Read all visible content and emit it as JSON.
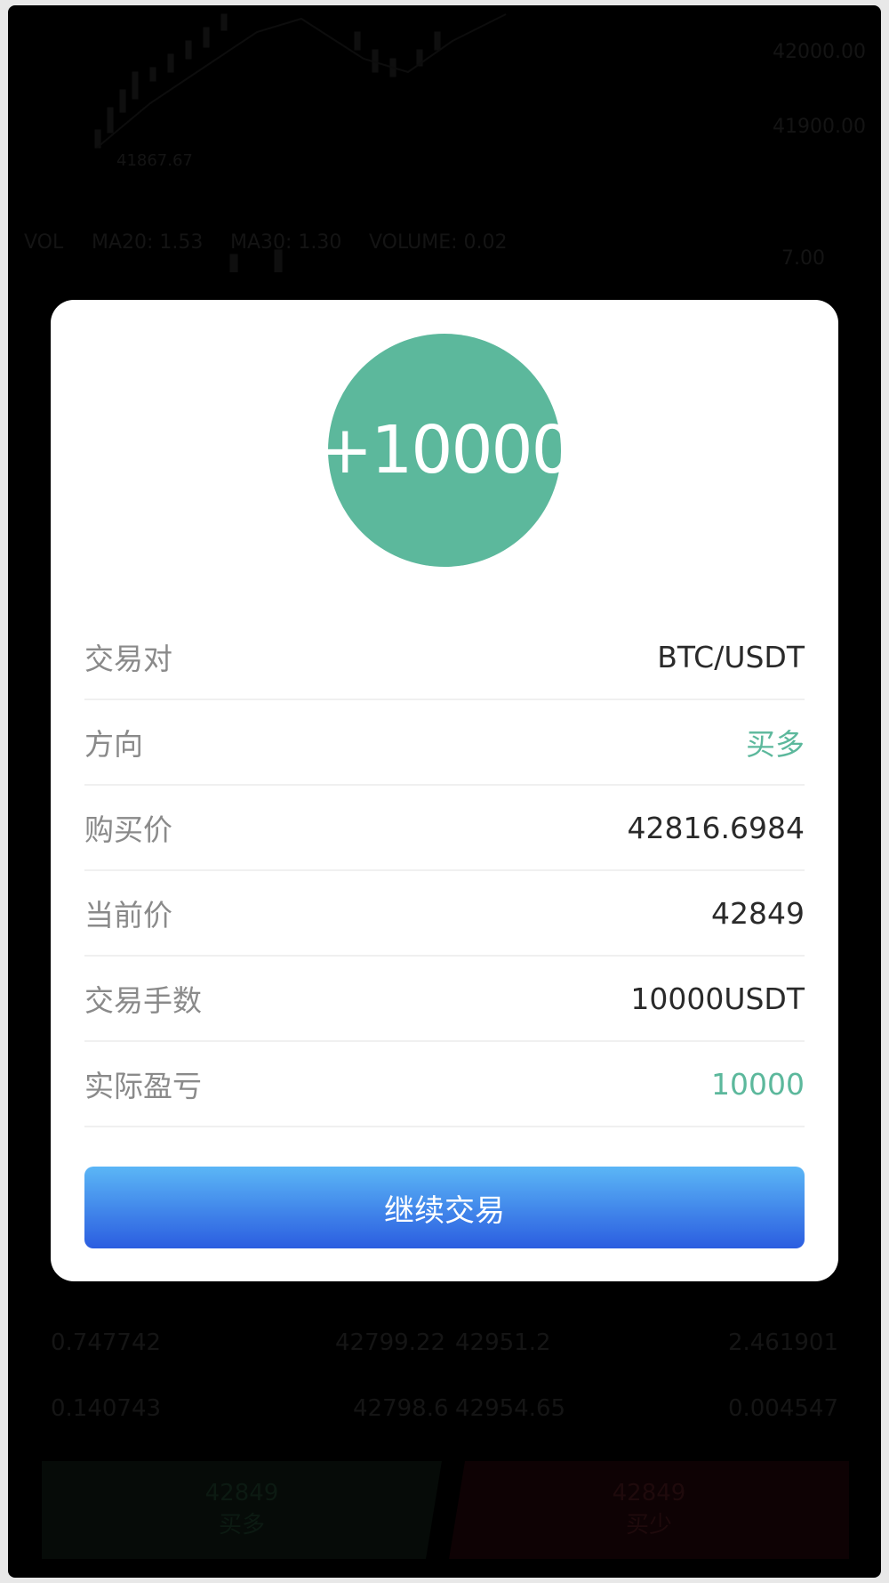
{
  "background": {
    "price_axis": [
      "42000.00",
      "41900.00"
    ],
    "low_marker": "41867.67",
    "indicators": {
      "vol": "VOL",
      "ma20": "MA20: 1.53",
      "ma30": "MA30: 1.30",
      "volume": "VOLUME: 0.02"
    },
    "vol_axis": "7.00",
    "order_rows": [
      {
        "amount_left": "0.747742",
        "price_left": "42799.22",
        "price_right": "42951.2",
        "amount_right": "2.461901"
      },
      {
        "amount_left": "0.140743",
        "price_left": "42798.6",
        "price_right": "42954.65",
        "amount_right": "0.004547"
      }
    ],
    "buy_button": {
      "price": "42849",
      "label": "买多"
    },
    "sell_button": {
      "price": "42849",
      "label": "买少"
    }
  },
  "modal": {
    "pnl_badge": "+10000",
    "rows": [
      {
        "label": "交易对",
        "value": "BTC/USDT"
      },
      {
        "label": "方向",
        "value": "买多"
      },
      {
        "label": "购买价",
        "value": "42816.6984"
      },
      {
        "label": "当前价",
        "value": "42849"
      },
      {
        "label": "交易手数",
        "value": "10000USDT"
      },
      {
        "label": "实际盈亏",
        "value": "10000"
      }
    ],
    "continue_button": "继续交易"
  },
  "colors": {
    "profit_green": "#5cb89c",
    "button_top": "#5bb6f6",
    "button_bottom": "#2b5de0"
  }
}
